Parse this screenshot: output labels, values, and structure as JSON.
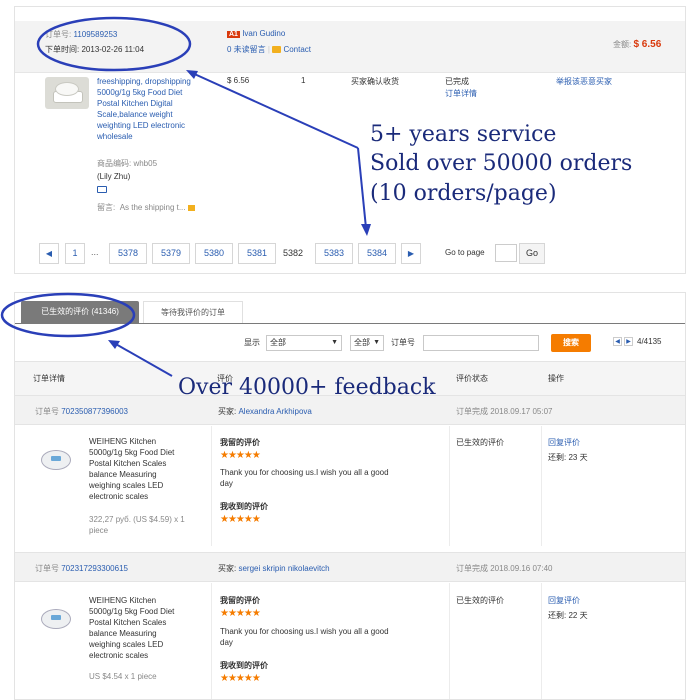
{
  "top": {
    "order_id_label": "订单号:",
    "order_id": "1109589253",
    "order_time_label": "下单时间:",
    "order_time": "2013-02-26 11:04",
    "buyer_badge": "A1",
    "buyer_name": "Ivan Gudino",
    "unread_msg": "0 未读留言",
    "contact": "Contact",
    "total_label": "金额:",
    "total_value": "$ 6.56",
    "product_lines": [
      "freeshipping, dropshipping",
      "5000g/1g 5kg Food Diet",
      "Postal Kitchen Digital",
      "Scale,balance weight",
      "weighting LED electronic",
      "wholesale"
    ],
    "product_code": "商品编码: whb05",
    "product_person": "(Lily Zhu)",
    "note_label": "留言:",
    "note_text": "As the shipping t...",
    "price": "$ 6.56",
    "qty": "1",
    "status_col": "买家确认收货",
    "done": "已完成",
    "order_detail": "订单详情",
    "extra_action": "举报该恶意买家",
    "pager": {
      "prev": "◀",
      "pages": [
        "1",
        "...",
        "5378",
        "5379",
        "5380",
        "5381",
        "5382",
        "5383",
        "5384"
      ],
      "next": "▶",
      "goto_label": "Go to page",
      "go_btn": "Go"
    }
  },
  "bottom": {
    "tab_active": "已生效的评价 (41346)",
    "tab_inactive": "等待我评价的订单",
    "show_label": "显示",
    "show_value": "全部",
    "filter2_value": "全部",
    "order_no_label": "订单号",
    "search_btn": "搜索",
    "page_info": "4/4135",
    "columns": [
      "订单详情",
      "评价",
      "评价状态",
      "操作"
    ],
    "rows": [
      {
        "order_label": "订单号",
        "order_id": "702350877396003",
        "buyer_label": "买家:",
        "buyer": "Alexandra Arkhipova",
        "finish": "订单完成 2018.09.17 05:07",
        "product_lines": [
          "WEIHENG Kitchen",
          "5000g/1g 5kg Food Diet",
          "Postal Kitchen Scales",
          "balance Measuring",
          "weighing scales LED",
          "electronic scales"
        ],
        "price_lines": [
          "322,27 руб. (US $4.59) x 1",
          "piece"
        ],
        "my_review_title": "我留的评价",
        "stars": "★★★★★",
        "review_lines": [
          "Thank you for choosing us.I wish you all a good",
          "day"
        ],
        "received_title": "我收到的评价",
        "received_stars": "★★★★★",
        "state": "已生效的评价",
        "reply": "回复评价",
        "remaining": "还剩:  23 天"
      },
      {
        "order_label": "订单号",
        "order_id": "702317293300615",
        "buyer_label": "买家:",
        "buyer": "sergei skripin nikolaevitch",
        "finish": "订单完成 2018.09.16 07:40",
        "product_lines": [
          "WEIHENG Kitchen",
          "5000g/1g 5kg Food Diet",
          "Postal Kitchen Scales",
          "balance Measuring",
          "weighing scales LED",
          "electronic scales"
        ],
        "price_lines": [
          "US $4.54 x 1 piece"
        ],
        "my_review_title": "我留的评价",
        "stars": "★★★★★",
        "review_lines": [
          "Thank you for choosing us.I wish you all a good",
          "day"
        ],
        "received_title": "我收到的评价",
        "received_stars": "★★★★★",
        "state": "已生效的评价",
        "reply": "回复评价",
        "remaining": "还剩:  22 天"
      }
    ]
  },
  "annotations": {
    "line1": "5+ years service",
    "line2": "Sold over 50000 orders",
    "line3": "(10 orders/page)",
    "feedback": "Over 40000+ feedback"
  },
  "colors": {
    "accent_orange": "#f57c00",
    "link_blue": "#2a5db0",
    "annotation_navy": "#1a2a7a",
    "price_red": "#d9390c"
  }
}
